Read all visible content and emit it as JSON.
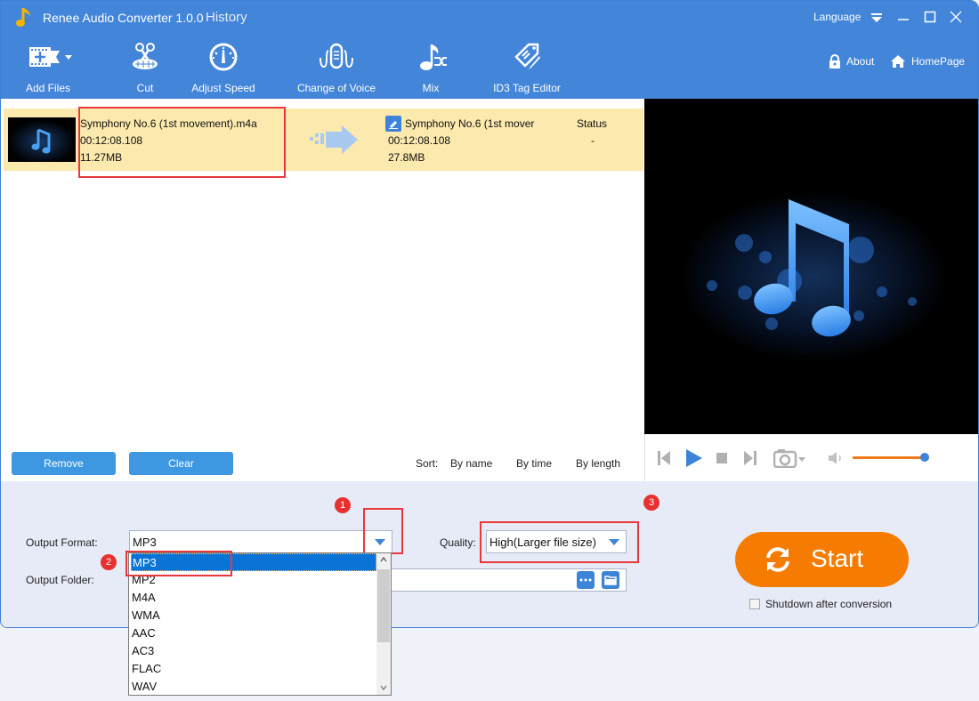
{
  "window": {
    "app_title": "Renee Audio Converter 1.0.0",
    "history_label": "History",
    "language_label": "Language",
    "controls": [
      "minimize",
      "maximize",
      "close"
    ]
  },
  "toolbar": {
    "items": [
      {
        "label": "Add Files",
        "icon": "add-files-icon"
      },
      {
        "label": "Cut",
        "icon": "scissors-icon"
      },
      {
        "label": "Adjust Speed",
        "icon": "speedometer-icon"
      },
      {
        "label": "Change of Voice",
        "icon": "microphone-icon"
      },
      {
        "label": "Mix",
        "icon": "music-shuffle-icon"
      },
      {
        "label": "ID3 Tag Editor",
        "icon": "tag-edit-icon"
      }
    ],
    "about_label": "About",
    "homepage_label": "HomePage"
  },
  "file_list": {
    "files": [
      {
        "source_name": "Symphony No.6 (1st movement).m4a",
        "source_duration": "00:12:08.108",
        "source_size": "11.27MB",
        "output_name": "Symphony No.6 (1st mover",
        "output_duration": "00:12:08.108",
        "output_size": "27.8MB",
        "status_header": "Status",
        "status_value": "-"
      }
    ],
    "remove_label": "Remove",
    "clear_label": "Clear",
    "sort_label": "Sort:",
    "sort_options": [
      "By name",
      "By time",
      "By length"
    ]
  },
  "player": {
    "volume": 1.0
  },
  "settings": {
    "output_format_label": "Output Format:",
    "output_format_value": "MP3",
    "quality_label": "Quality:",
    "quality_value": "High(Larger file size)",
    "output_folder_label": "Output Folder:",
    "output_folder_value": "",
    "format_options": [
      "MP3",
      "MP2",
      "M4A",
      "WMA",
      "AAC",
      "AC3",
      "FLAC",
      "WAV"
    ],
    "selected_format_index": 0
  },
  "annotations": {
    "badges": [
      "1",
      "2",
      "3"
    ]
  },
  "start": {
    "label": "Start",
    "shutdown_label": "Shutdown after conversion",
    "shutdown_checked": false
  },
  "colors": {
    "titlebar": "#4285d9",
    "accent_orange": "#f57c00",
    "row_highlight": "#fbe9ae",
    "annotation_red": "#e8383b",
    "selection_blue": "#0a74d6"
  }
}
